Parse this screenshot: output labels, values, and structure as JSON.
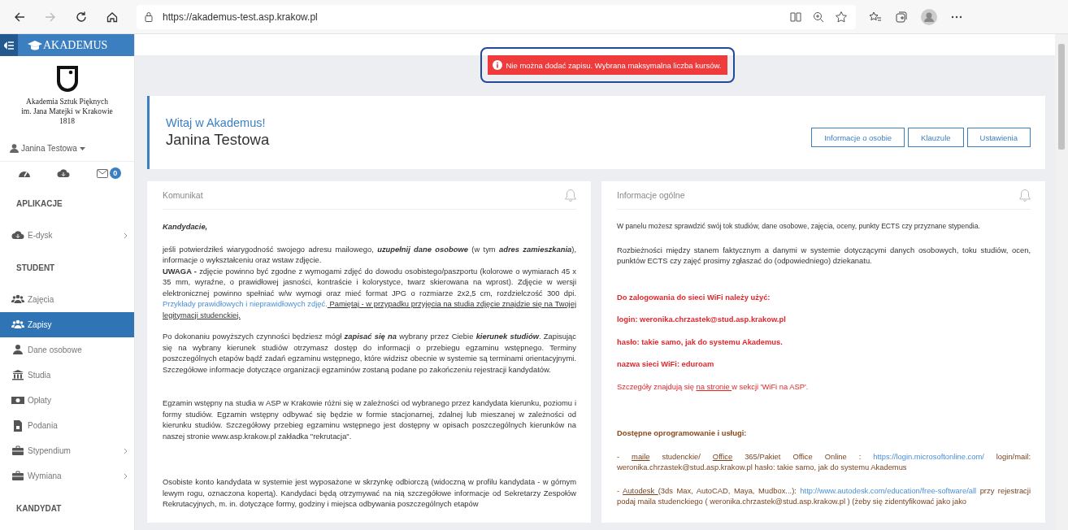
{
  "browser": {
    "url": "https://akademus-test.asp.krakow.pl",
    "back_disabled": false,
    "forward_disabled": true
  },
  "sidebar": {
    "brand": "AKADEMUS",
    "institution": [
      "Akademia Sztuk Pięknych",
      "im. Jana Matejki w Krakowie",
      "1818"
    ],
    "user": "Janina Testowa",
    "mail_count": "0",
    "sections": [
      {
        "title": "APLIKACJE",
        "items": [
          {
            "label": "E-dysk",
            "selected": false,
            "has_submenu": true
          }
        ]
      },
      {
        "title": "STUDENT",
        "items": [
          {
            "label": "Zajęcia",
            "selected": false,
            "has_submenu": false
          },
          {
            "label": "Zapisy",
            "selected": true,
            "has_submenu": false
          },
          {
            "label": "Dane osobowe",
            "selected": false,
            "has_submenu": false
          },
          {
            "label": "Studia",
            "selected": false,
            "has_submenu": false
          },
          {
            "label": "Opłaty",
            "selected": false,
            "has_submenu": false
          },
          {
            "label": "Podania",
            "selected": false,
            "has_submenu": false
          },
          {
            "label": "Stypendium",
            "selected": false,
            "has_submenu": true
          },
          {
            "label": "Wymiana",
            "selected": false,
            "has_submenu": true
          }
        ]
      },
      {
        "title": "KANDYDAT"
      }
    ]
  },
  "alert": {
    "text": "Nie można dodać zapisu. Wybrana maksymalna liczba kursów.",
    "highlighted": true
  },
  "header": {
    "greeting": "Witaj w Akademus!",
    "name": "Janina Testowa",
    "buttons": [
      "Informacje o osobie",
      "Klauzule",
      "Ustawienia"
    ]
  },
  "panels": [
    {
      "title": "Komunikat",
      "paragraphs": [
        {
          "kind": "lead",
          "segments": [
            {
              "kind": "text",
              "text": "Kandydacie,"
            }
          ]
        },
        {
          "kind": "normal",
          "segments": [
            {
              "kind": "text",
              "text": "jeśli potwierdziłeś wiarygodność swojego adresu mailowego, *uzupełnij dane osobowe* (w tym *adres zamieszkania*), informacje o wykształceniu oraz wstaw zdjęcie."
            },
            {
              "kind": "break"
            },
            {
              "kind": "text",
              "text": "**UWAGA -** zdjęcie powinno być zgodne z wymogami zdjęć do dowodu osobistego/paszportu (kolorowe o wymiarach 45 x 35 mm, wyraźne, o prawidłowej jasności, kontraście i kolorystyce, twarz skierowana na wprost). Zdjęcie w wersji elektronicznej powinno spełniać w/w wymogi oraz mieć format JPG o rozmiarze 2x2,5 cm, rozdzielczość 300 dpi. "
            },
            {
              "kind": "link",
              "text": "Przykłady prawidłowych i nieprawidłowych zdjęć."
            },
            {
              "kind": "underline",
              "text": " Pamiętaj - w przypadku przyjęcia na studia zdjęcie znajdzie się na Twojej legitymacji studenckiej."
            }
          ]
        },
        {
          "kind": "normal",
          "segments": [
            {
              "kind": "text",
              "text": "Po dokonaniu powyższych czynności będziesz mógł *zapisać się na* wybrany przez Ciebie *kierunek studiów*. Zapisując się na wybrany kierunek studiów otrzymasz dostęp do informacji o przebiegu egzaminu wstępnego. Terminy poszczególnych etapów bądź zadań egzaminu wstępnego, które widzisz obecnie w systemie są terminami orientacyjnymi. Szczegółowe informacje dotyczące organizacji egzaminów zostaną podane po zakończeniu rejestracji kandydatów."
            }
          ]
        },
        {
          "kind": "normal",
          "segments": [
            {
              "kind": "text",
              "text": "Egzamin wstępny na studia w ASP w Krakowie różni się w zależności od wybranego przez kandydata kierunku, poziomu i formy studiów. Egzamin wstępny odbywać się będzie w formie stacjonarnej, zdalnej lub mieszanej w zależności od kierunku studiów. Szczegółowy przebieg egzaminu wstępnego jest dostępny w opisach poszczególnych kierunków na naszej stronie www.asp.krakow.pl zakładka \"rekrutacja\"."
            }
          ]
        },
        {
          "kind": "normal",
          "segments": [
            {
              "kind": "text",
              "text": "Osobiste konto kandydata w systemie jest wyposażone w skrzynkę odbiorczą (widoczną w profilu kandydata - w górnym lewym rogu, oznaczona kopertą). Kandydaci będą otrzymywać na nią szczegółowe informacje od Sekretarzy Zespołów Rekrutacyjnych, m. in. dotyczące formy, godziny i miejsca odbywania poszczególnych etapów"
            }
          ]
        }
      ]
    },
    {
      "title": "Informacje ogólne",
      "paragraphs": [
        {
          "kind": "small",
          "segments": [
            {
              "kind": "text",
              "text": "W panelu możesz sprawdzić swój tok studiów, dane osobowe, zajęcia, oceny, punkty ECTS czy przyznane stypendia."
            }
          ]
        },
        {
          "kind": "normal",
          "segments": [
            {
              "kind": "text",
              "text": "Rozbieżności między stanem faktycznym a danymi w systemie dotyczącymi danych osobowych, toku studiów, ocen, punktów ECTS czy zajęć prosimy zgłaszać do (odpowiedniego) dziekanatu."
            }
          ]
        },
        {
          "kind": "alert",
          "segments": [
            {
              "kind": "text",
              "text": "Do zalogowania do sieci WiFi należy użyć:"
            }
          ]
        },
        {
          "kind": "alert",
          "segments": [
            {
              "kind": "text",
              "text": "login: weronika.chrzastek@stud.asp.krakow.pl"
            }
          ]
        },
        {
          "kind": "alert",
          "segments": [
            {
              "kind": "text",
              "text": "hasło: takie samo, jak do systemu Akademus."
            }
          ]
        },
        {
          "kind": "alert",
          "segments": [
            {
              "kind": "text",
              "text": "nazwa sieci WiFi: eduroam"
            }
          ]
        },
        {
          "kind": "alert-note",
          "segments": [
            {
              "kind": "text",
              "text": "Szczegóły znajdują się "
            },
            {
              "kind": "underline",
              "text": "na stronie "
            },
            {
              "kind": "text",
              "text": "w sekcji 'WiFi na ASP'."
            }
          ]
        },
        {
          "kind": "heading",
          "segments": [
            {
              "kind": "text",
              "text": "Dostępne oprogramowanie i usługi:"
            }
          ]
        },
        {
          "kind": "software",
          "segments": [
            {
              "kind": "text",
              "text": "- "
            },
            {
              "kind": "underline",
              "text": "maile"
            },
            {
              "kind": "text",
              "text": " studenckie/ "
            },
            {
              "kind": "underline",
              "text": "Office"
            },
            {
              "kind": "text",
              "text": " 365/Pakiet Office Online : "
            },
            {
              "kind": "link",
              "text": "https://login.microsoftonline.com/"
            },
            {
              "kind": "text",
              "text": " login/mail: weronika.chrzastek@stud.asp.krakow.pl hasło: takie samo, jak do systemu Akademus"
            }
          ]
        },
        {
          "kind": "software",
          "segments": [
            {
              "kind": "text",
              "text": "- "
            },
            {
              "kind": "underline",
              "text": "Autodesk "
            },
            {
              "kind": "text",
              "text": "(3ds Max, AutoCAD, Maya, Mudbox...): "
            },
            {
              "kind": "link",
              "text": "http://www.autodesk.com/education/free-software/all"
            },
            {
              "kind": "text",
              "text": " przy rejestracji podaj maila studenckiego ( weronika.chrzastek@stud.asp.krakow.pl ) (żeby się zidentyfikować jako jako"
            }
          ]
        }
      ]
    }
  ]
}
